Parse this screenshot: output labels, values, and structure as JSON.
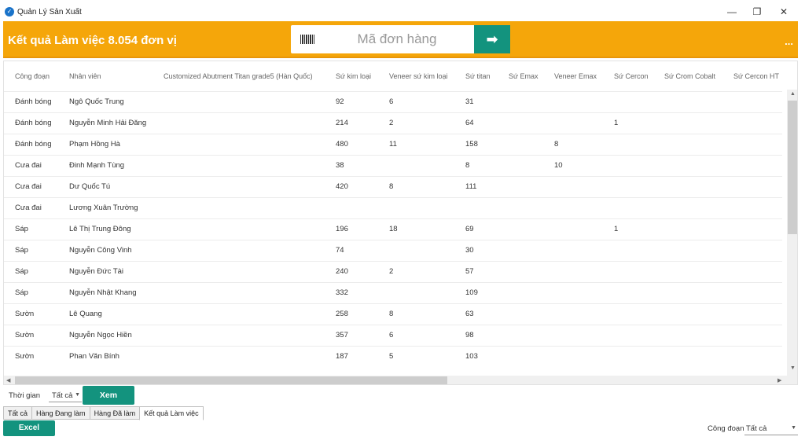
{
  "window": {
    "title": "Quản Lý Sản Xuất",
    "minimize": "—",
    "restore": "❐",
    "close": "✕"
  },
  "banner": {
    "summary": "Kết quả Làm việc  8.054  đơn vị",
    "search_placeholder": "Mã đơn hàng",
    "go_icon": "➡",
    "more": "..."
  },
  "table": {
    "columns": [
      "Công đoạn",
      "Nhân viên",
      "Customized Abutment Titan grade5 (Hàn Quốc)",
      "Sứ kim loại",
      "Veneer sứ kim loại",
      "Sứ titan",
      "Sứ Emax",
      "Veneer Emax",
      "Sứ Cercon",
      "Sứ Crom Cobalt",
      "Sứ Cercon HT"
    ],
    "rows": [
      [
        "Đánh bóng",
        "Ngô Quốc Trung",
        "",
        "92",
        "6",
        "31",
        "",
        "",
        "",
        "",
        ""
      ],
      [
        "Đánh bóng",
        "Nguyễn Minh Hải Đăng",
        "",
        "214",
        "2",
        "64",
        "",
        "",
        "1",
        "",
        ""
      ],
      [
        "Đánh bóng",
        "Phạm Hồng Hà",
        "",
        "480",
        "11",
        "158",
        "",
        "8",
        "",
        "",
        ""
      ],
      [
        "Cưa đai",
        "Đinh Mạnh Tùng",
        "",
        "38",
        "",
        "8",
        "",
        "10",
        "",
        "",
        ""
      ],
      [
        "Cưa đai",
        "Dư Quốc Tú",
        "",
        "420",
        "8",
        "111",
        "",
        "",
        "",
        "",
        ""
      ],
      [
        "Cưa đai",
        "Lương Xuân Trường",
        "",
        "",
        "",
        "",
        "",
        "",
        "",
        "",
        ""
      ],
      [
        "Sáp",
        "Lê Thị Trung Đông",
        "",
        "196",
        "18",
        "69",
        "",
        "",
        "1",
        "",
        ""
      ],
      [
        "Sáp",
        "Nguyễn Công Vinh",
        "",
        "74",
        "",
        "30",
        "",
        "",
        "",
        "",
        ""
      ],
      [
        "Sáp",
        "Nguyễn Đức Tài",
        "",
        "240",
        "2",
        "57",
        "",
        "",
        "",
        "",
        ""
      ],
      [
        "Sáp",
        "Nguyễn Nhật Khang",
        "",
        "332",
        "",
        "109",
        "",
        "",
        "",
        "",
        ""
      ],
      [
        "Sườn",
        "Lê Quang",
        "",
        "258",
        "8",
        "63",
        "",
        "",
        "",
        "",
        ""
      ],
      [
        "Sườn",
        "Nguyễn Ngọc Hiền",
        "",
        "357",
        "6",
        "98",
        "",
        "",
        "",
        "",
        ""
      ],
      [
        "Sườn",
        "Phan Văn Bính",
        "",
        "187",
        "5",
        "103",
        "",
        "",
        "",
        "",
        ""
      ]
    ]
  },
  "filter": {
    "time_label": "Thời gian",
    "time_value": "Tất cả",
    "view_button": "Xem"
  },
  "tabs": [
    "Tất cả",
    "Hàng Đang làm",
    "Hàng Đã làm",
    "Kết quả Làm việc"
  ],
  "footer": {
    "excel_button": "Excel",
    "stage_label": "Công đoạn",
    "stage_value": "Tất cả"
  },
  "colors": {
    "accent": "#f5a60a",
    "button": "#13937e"
  }
}
